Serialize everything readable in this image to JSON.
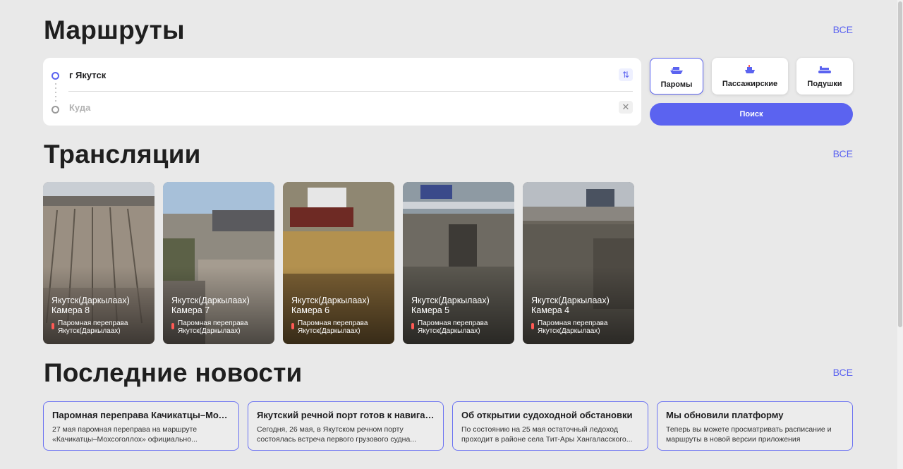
{
  "routes": {
    "title": "Маршруты",
    "see_all": "ВСЕ",
    "from_value": "г Якутск",
    "to_placeholder": "Куда",
    "types": [
      {
        "label": "Паромы",
        "icon": "ferry-icon",
        "active": true
      },
      {
        "label": "Пассажирские",
        "icon": "passenger-ship-icon",
        "active": false
      },
      {
        "label": "Подушки",
        "icon": "hovercraft-icon",
        "active": false
      }
    ],
    "search_label": "Поиск",
    "accent_color": "#5b63f0"
  },
  "broadcasts": {
    "title": "Трансляции",
    "see_all": "ВСЕ",
    "cameras": [
      {
        "name": "Якутск(Даркылаах) Камера 8",
        "location": "Паромная переправа Якутск(Даркылаах)"
      },
      {
        "name": "Якутск(Даркылаах) Камера 7",
        "location": "Паромная переправа Якутск(Даркылаах)"
      },
      {
        "name": "Якутск(Даркылаах) Камера 6",
        "location": "Паромная переправа Якутск(Даркылаах)"
      },
      {
        "name": "Якутск(Даркылаах) Камера 5",
        "location": "Паромная переправа Якутск(Даркылаах)"
      },
      {
        "name": "Якутск(Даркылаах) Камера 4",
        "location": "Паромная переправа Якутск(Даркылаах)"
      }
    ]
  },
  "news": {
    "title": "Последние новости",
    "see_all": "ВСЕ",
    "items": [
      {
        "title": "Паромная переправа Качикатцы–Мохсоголлох",
        "text": "27 мая паромная переправа на маршруте «Качикатцы–Мохсоголлох» официально..."
      },
      {
        "title": "Якутский речной порт готов к навигации",
        "text": "Сегодня, 26 мая, в Якутском речном порту состоялась встреча первого грузового судна..."
      },
      {
        "title": "Об открытии судоходной обстановки",
        "text": "По состоянию на 25 мая остаточный ледоход проходит в районе села Тит-Ары Хангаласского..."
      },
      {
        "title": "Мы обновили платформу",
        "text": "Теперь вы можете просматривать расписание и маршруты в новой версии приложения"
      }
    ]
  }
}
